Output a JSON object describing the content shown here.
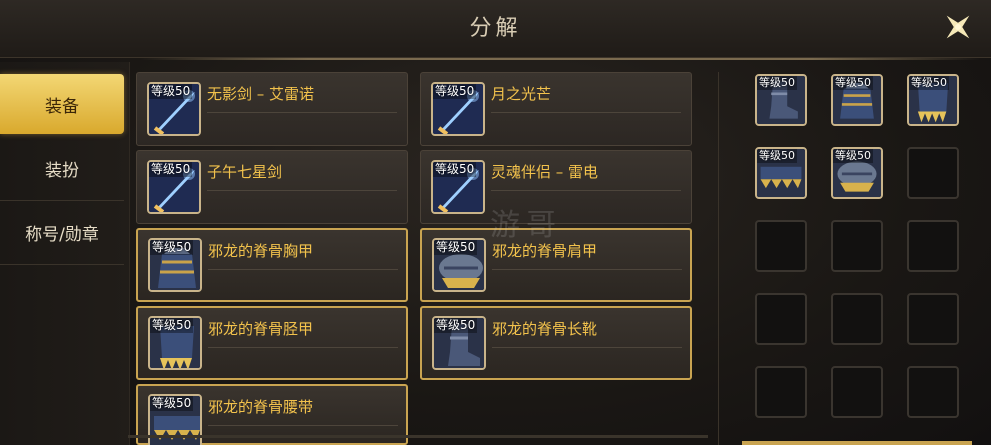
{
  "title": "分解",
  "tabs": [
    {
      "label": "装备",
      "active": true
    },
    {
      "label": "装扮",
      "active": false
    },
    {
      "label": "称号/勋章",
      "active": false
    }
  ],
  "level_badge": "等级50",
  "items": [
    {
      "name": "无影剑 – 艾雷诺",
      "icon": "sword-icon",
      "selected": false
    },
    {
      "name": "月之光芒",
      "icon": "sword-icon",
      "selected": false
    },
    {
      "name": "子午七星剑",
      "icon": "sword-icon",
      "selected": false
    },
    {
      "name": "灵魂伴侣 – 雷电",
      "icon": "sword-icon",
      "selected": false
    },
    {
      "name": "邪龙的脊骨胸甲",
      "icon": "chest-armor-icon",
      "selected": true
    },
    {
      "name": "邪龙的脊骨肩甲",
      "icon": "shoulder-armor-icon",
      "selected": true
    },
    {
      "name": "邪龙的脊骨胫甲",
      "icon": "leg-armor-icon",
      "selected": true
    },
    {
      "name": "邪龙的脊骨长靴",
      "icon": "boots-icon",
      "selected": true
    },
    {
      "name": "邪龙的脊骨腰带",
      "icon": "belt-icon",
      "selected": true
    }
  ],
  "slots": [
    {
      "filled": true,
      "icon": "boots-icon"
    },
    {
      "filled": true,
      "icon": "chest-armor-icon"
    },
    {
      "filled": true,
      "icon": "leg-armor-icon"
    },
    {
      "filled": true,
      "icon": "belt-icon"
    },
    {
      "filled": true,
      "icon": "shoulder-armor-icon"
    },
    {
      "filled": false
    },
    {
      "filled": false
    },
    {
      "filled": false
    },
    {
      "filled": false
    },
    {
      "filled": false
    },
    {
      "filled": false
    },
    {
      "filled": false
    },
    {
      "filled": false
    },
    {
      "filled": false
    },
    {
      "filled": false
    }
  ],
  "watermark": "游哥",
  "colors": {
    "accent_gold": "#f2c24c",
    "tab_active": "#e6bf4a",
    "border_gold": "#c9a451"
  }
}
